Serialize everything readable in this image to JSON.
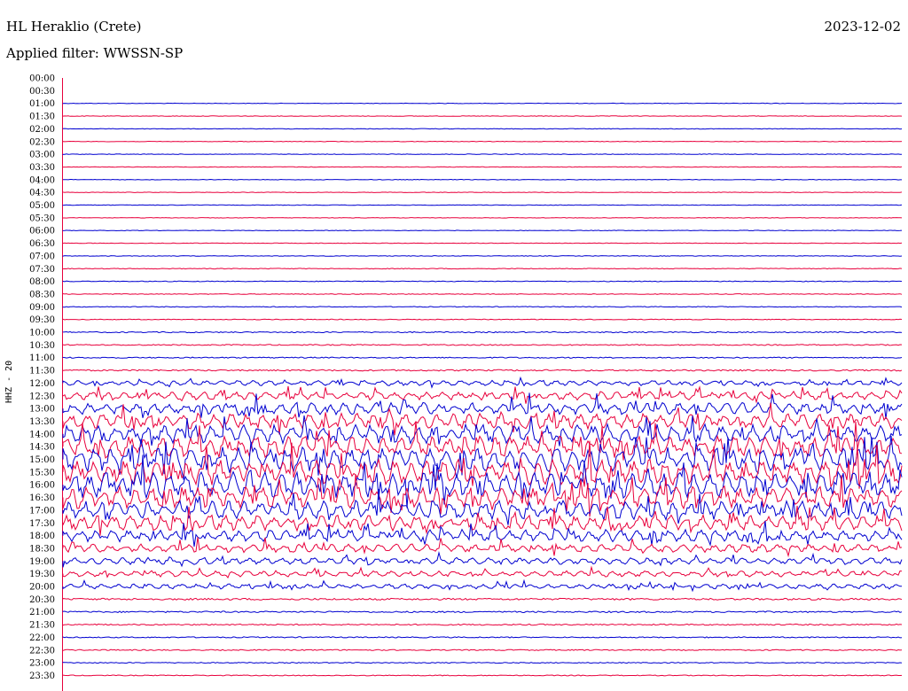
{
  "header": {
    "station": "HL Heraklio (Crete)",
    "date": "2023-12-02",
    "filter": "Applied filter: WWSSN-SP",
    "channel": "HHZ - 20"
  },
  "chart_data": {
    "type": "line",
    "title": "HL Heraklio (Crete)",
    "subtitle": "Applied filter: WWSSN-SP",
    "ylabel": "HHZ - 20",
    "y_tick_labels": [
      "00:00",
      "00:30",
      "01:00",
      "01:30",
      "02:00",
      "02:30",
      "03:00",
      "03:30",
      "04:00",
      "04:30",
      "05:00",
      "05:30",
      "06:00",
      "06:30",
      "07:00",
      "07:30",
      "08:00",
      "08:30",
      "09:00",
      "09:30",
      "10:00",
      "10:30",
      "11:00",
      "11:30",
      "12:00",
      "12:30",
      "13:00",
      "13:30",
      "14:00",
      "14:30",
      "15:00",
      "15:30",
      "16:00",
      "16:30",
      "17:00",
      "17:30",
      "18:00",
      "18:30",
      "19:00",
      "19:30",
      "20:00",
      "20:30",
      "21:00",
      "21:30",
      "22:00",
      "22:30",
      "23:00",
      "23:30"
    ],
    "series_colors": [
      "#0000d0",
      "#e8003c"
    ],
    "relative_activity": [
      0.15,
      0.15,
      0.15,
      0.15,
      0.15,
      0.15,
      0.15,
      0.15,
      0.15,
      0.15,
      0.15,
      0.15,
      0.15,
      0.15,
      0.15,
      0.2,
      0.2,
      0.2,
      0.2,
      0.2,
      0.3,
      0.3,
      0.3,
      0.4,
      0.6,
      1.0,
      1.4,
      1.8,
      2.2,
      2.6,
      2.8,
      3.0,
      3.0,
      2.6,
      2.2,
      1.8,
      1.4,
      1.0,
      0.8,
      0.7,
      0.6,
      0.5,
      0.4,
      0.35,
      0.3,
      0.3,
      0.25,
      0.25
    ],
    "grid": false,
    "legend": "none"
  }
}
